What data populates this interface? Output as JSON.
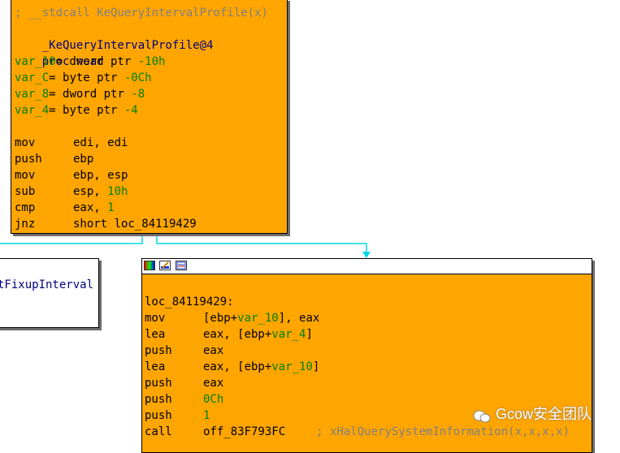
{
  "top_block": {
    "comment": "; __stdcall KeQueryIntervalProfile(x)",
    "proc_name": "_KeQueryIntervalProfile@4",
    "proc_kw": "proc near",
    "vars": [
      {
        "name": "var_10",
        "decl": "= dword ptr ",
        "offset": "-10h"
      },
      {
        "name": "var_C",
        "decl": "= byte ptr ",
        "offset": "-0Ch"
      },
      {
        "name": "var_8",
        "decl": "= dword ptr ",
        "offset": "-8"
      },
      {
        "name": "var_4",
        "decl": "= byte ptr ",
        "offset": "-4"
      }
    ],
    "instructions": [
      {
        "mnemonic": "mov",
        "operands": "edi, edi"
      },
      {
        "mnemonic": "push",
        "operands": "ebp"
      },
      {
        "mnemonic": "mov",
        "operands": "ebp, esp"
      },
      {
        "mnemonic": "sub",
        "operands_pre": "esp, ",
        "operands_num": "10h"
      },
      {
        "mnemonic": "cmp",
        "operands_pre": "eax, ",
        "operands_num": "1"
      },
      {
        "mnemonic": "jnz",
        "operands": "short loc_84119429"
      }
    ]
  },
  "left_block": {
    "text": "tFixupInterval"
  },
  "right_block": {
    "label": "loc_84119429:",
    "instructions": [
      {
        "mnemonic": "mov",
        "pre": "[ebp+",
        "var": "var_10",
        "post": "], eax"
      },
      {
        "mnemonic": "lea",
        "pre": "eax, [ebp+",
        "var": "var_4",
        "post": "]"
      },
      {
        "mnemonic": "push",
        "pre": "eax"
      },
      {
        "mnemonic": "lea",
        "pre": "eax, [ebp+",
        "var": "var_10",
        "post": "]"
      },
      {
        "mnemonic": "push",
        "pre": "eax"
      },
      {
        "mnemonic": "push",
        "num": "0Ch"
      },
      {
        "mnemonic": "push",
        "num": "1"
      },
      {
        "mnemonic": "call",
        "pre": "off_83F793FC",
        "comment": "; xHalQuerySystemInformation(x,x,x,x)"
      }
    ]
  },
  "watermark": {
    "text": "Gcow安全团队"
  },
  "colors": {
    "block_bg": "#ffa500",
    "edge": "#00d7e6",
    "name": "#000080",
    "var": "#008000",
    "comment": "#808080"
  }
}
